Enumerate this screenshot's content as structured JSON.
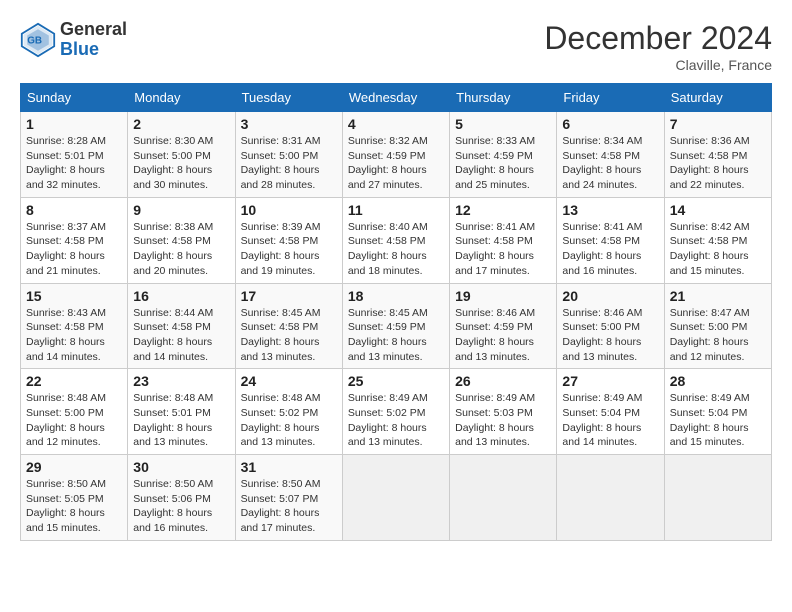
{
  "header": {
    "logo_line1": "General",
    "logo_line2": "Blue",
    "month_year": "December 2024",
    "location": "Claville, France"
  },
  "days_of_week": [
    "Sunday",
    "Monday",
    "Tuesday",
    "Wednesday",
    "Thursday",
    "Friday",
    "Saturday"
  ],
  "weeks": [
    [
      {
        "day": "1",
        "info": "Sunrise: 8:28 AM\nSunset: 5:01 PM\nDaylight: 8 hours and 32 minutes."
      },
      {
        "day": "2",
        "info": "Sunrise: 8:30 AM\nSunset: 5:00 PM\nDaylight: 8 hours and 30 minutes."
      },
      {
        "day": "3",
        "info": "Sunrise: 8:31 AM\nSunset: 5:00 PM\nDaylight: 8 hours and 28 minutes."
      },
      {
        "day": "4",
        "info": "Sunrise: 8:32 AM\nSunset: 4:59 PM\nDaylight: 8 hours and 27 minutes."
      },
      {
        "day": "5",
        "info": "Sunrise: 8:33 AM\nSunset: 4:59 PM\nDaylight: 8 hours and 25 minutes."
      },
      {
        "day": "6",
        "info": "Sunrise: 8:34 AM\nSunset: 4:58 PM\nDaylight: 8 hours and 24 minutes."
      },
      {
        "day": "7",
        "info": "Sunrise: 8:36 AM\nSunset: 4:58 PM\nDaylight: 8 hours and 22 minutes."
      }
    ],
    [
      {
        "day": "8",
        "info": "Sunrise: 8:37 AM\nSunset: 4:58 PM\nDaylight: 8 hours and 21 minutes."
      },
      {
        "day": "9",
        "info": "Sunrise: 8:38 AM\nSunset: 4:58 PM\nDaylight: 8 hours and 20 minutes."
      },
      {
        "day": "10",
        "info": "Sunrise: 8:39 AM\nSunset: 4:58 PM\nDaylight: 8 hours and 19 minutes."
      },
      {
        "day": "11",
        "info": "Sunrise: 8:40 AM\nSunset: 4:58 PM\nDaylight: 8 hours and 18 minutes."
      },
      {
        "day": "12",
        "info": "Sunrise: 8:41 AM\nSunset: 4:58 PM\nDaylight: 8 hours and 17 minutes."
      },
      {
        "day": "13",
        "info": "Sunrise: 8:41 AM\nSunset: 4:58 PM\nDaylight: 8 hours and 16 minutes."
      },
      {
        "day": "14",
        "info": "Sunrise: 8:42 AM\nSunset: 4:58 PM\nDaylight: 8 hours and 15 minutes."
      }
    ],
    [
      {
        "day": "15",
        "info": "Sunrise: 8:43 AM\nSunset: 4:58 PM\nDaylight: 8 hours and 14 minutes."
      },
      {
        "day": "16",
        "info": "Sunrise: 8:44 AM\nSunset: 4:58 PM\nDaylight: 8 hours and 14 minutes."
      },
      {
        "day": "17",
        "info": "Sunrise: 8:45 AM\nSunset: 4:58 PM\nDaylight: 8 hours and 13 minutes."
      },
      {
        "day": "18",
        "info": "Sunrise: 8:45 AM\nSunset: 4:59 PM\nDaylight: 8 hours and 13 minutes."
      },
      {
        "day": "19",
        "info": "Sunrise: 8:46 AM\nSunset: 4:59 PM\nDaylight: 8 hours and 13 minutes."
      },
      {
        "day": "20",
        "info": "Sunrise: 8:46 AM\nSunset: 5:00 PM\nDaylight: 8 hours and 13 minutes."
      },
      {
        "day": "21",
        "info": "Sunrise: 8:47 AM\nSunset: 5:00 PM\nDaylight: 8 hours and 12 minutes."
      }
    ],
    [
      {
        "day": "22",
        "info": "Sunrise: 8:48 AM\nSunset: 5:00 PM\nDaylight: 8 hours and 12 minutes."
      },
      {
        "day": "23",
        "info": "Sunrise: 8:48 AM\nSunset: 5:01 PM\nDaylight: 8 hours and 13 minutes."
      },
      {
        "day": "24",
        "info": "Sunrise: 8:48 AM\nSunset: 5:02 PM\nDaylight: 8 hours and 13 minutes."
      },
      {
        "day": "25",
        "info": "Sunrise: 8:49 AM\nSunset: 5:02 PM\nDaylight: 8 hours and 13 minutes."
      },
      {
        "day": "26",
        "info": "Sunrise: 8:49 AM\nSunset: 5:03 PM\nDaylight: 8 hours and 13 minutes."
      },
      {
        "day": "27",
        "info": "Sunrise: 8:49 AM\nSunset: 5:04 PM\nDaylight: 8 hours and 14 minutes."
      },
      {
        "day": "28",
        "info": "Sunrise: 8:49 AM\nSunset: 5:04 PM\nDaylight: 8 hours and 15 minutes."
      }
    ],
    [
      {
        "day": "29",
        "info": "Sunrise: 8:50 AM\nSunset: 5:05 PM\nDaylight: 8 hours and 15 minutes."
      },
      {
        "day": "30",
        "info": "Sunrise: 8:50 AM\nSunset: 5:06 PM\nDaylight: 8 hours and 16 minutes."
      },
      {
        "day": "31",
        "info": "Sunrise: 8:50 AM\nSunset: 5:07 PM\nDaylight: 8 hours and 17 minutes."
      },
      null,
      null,
      null,
      null
    ]
  ]
}
